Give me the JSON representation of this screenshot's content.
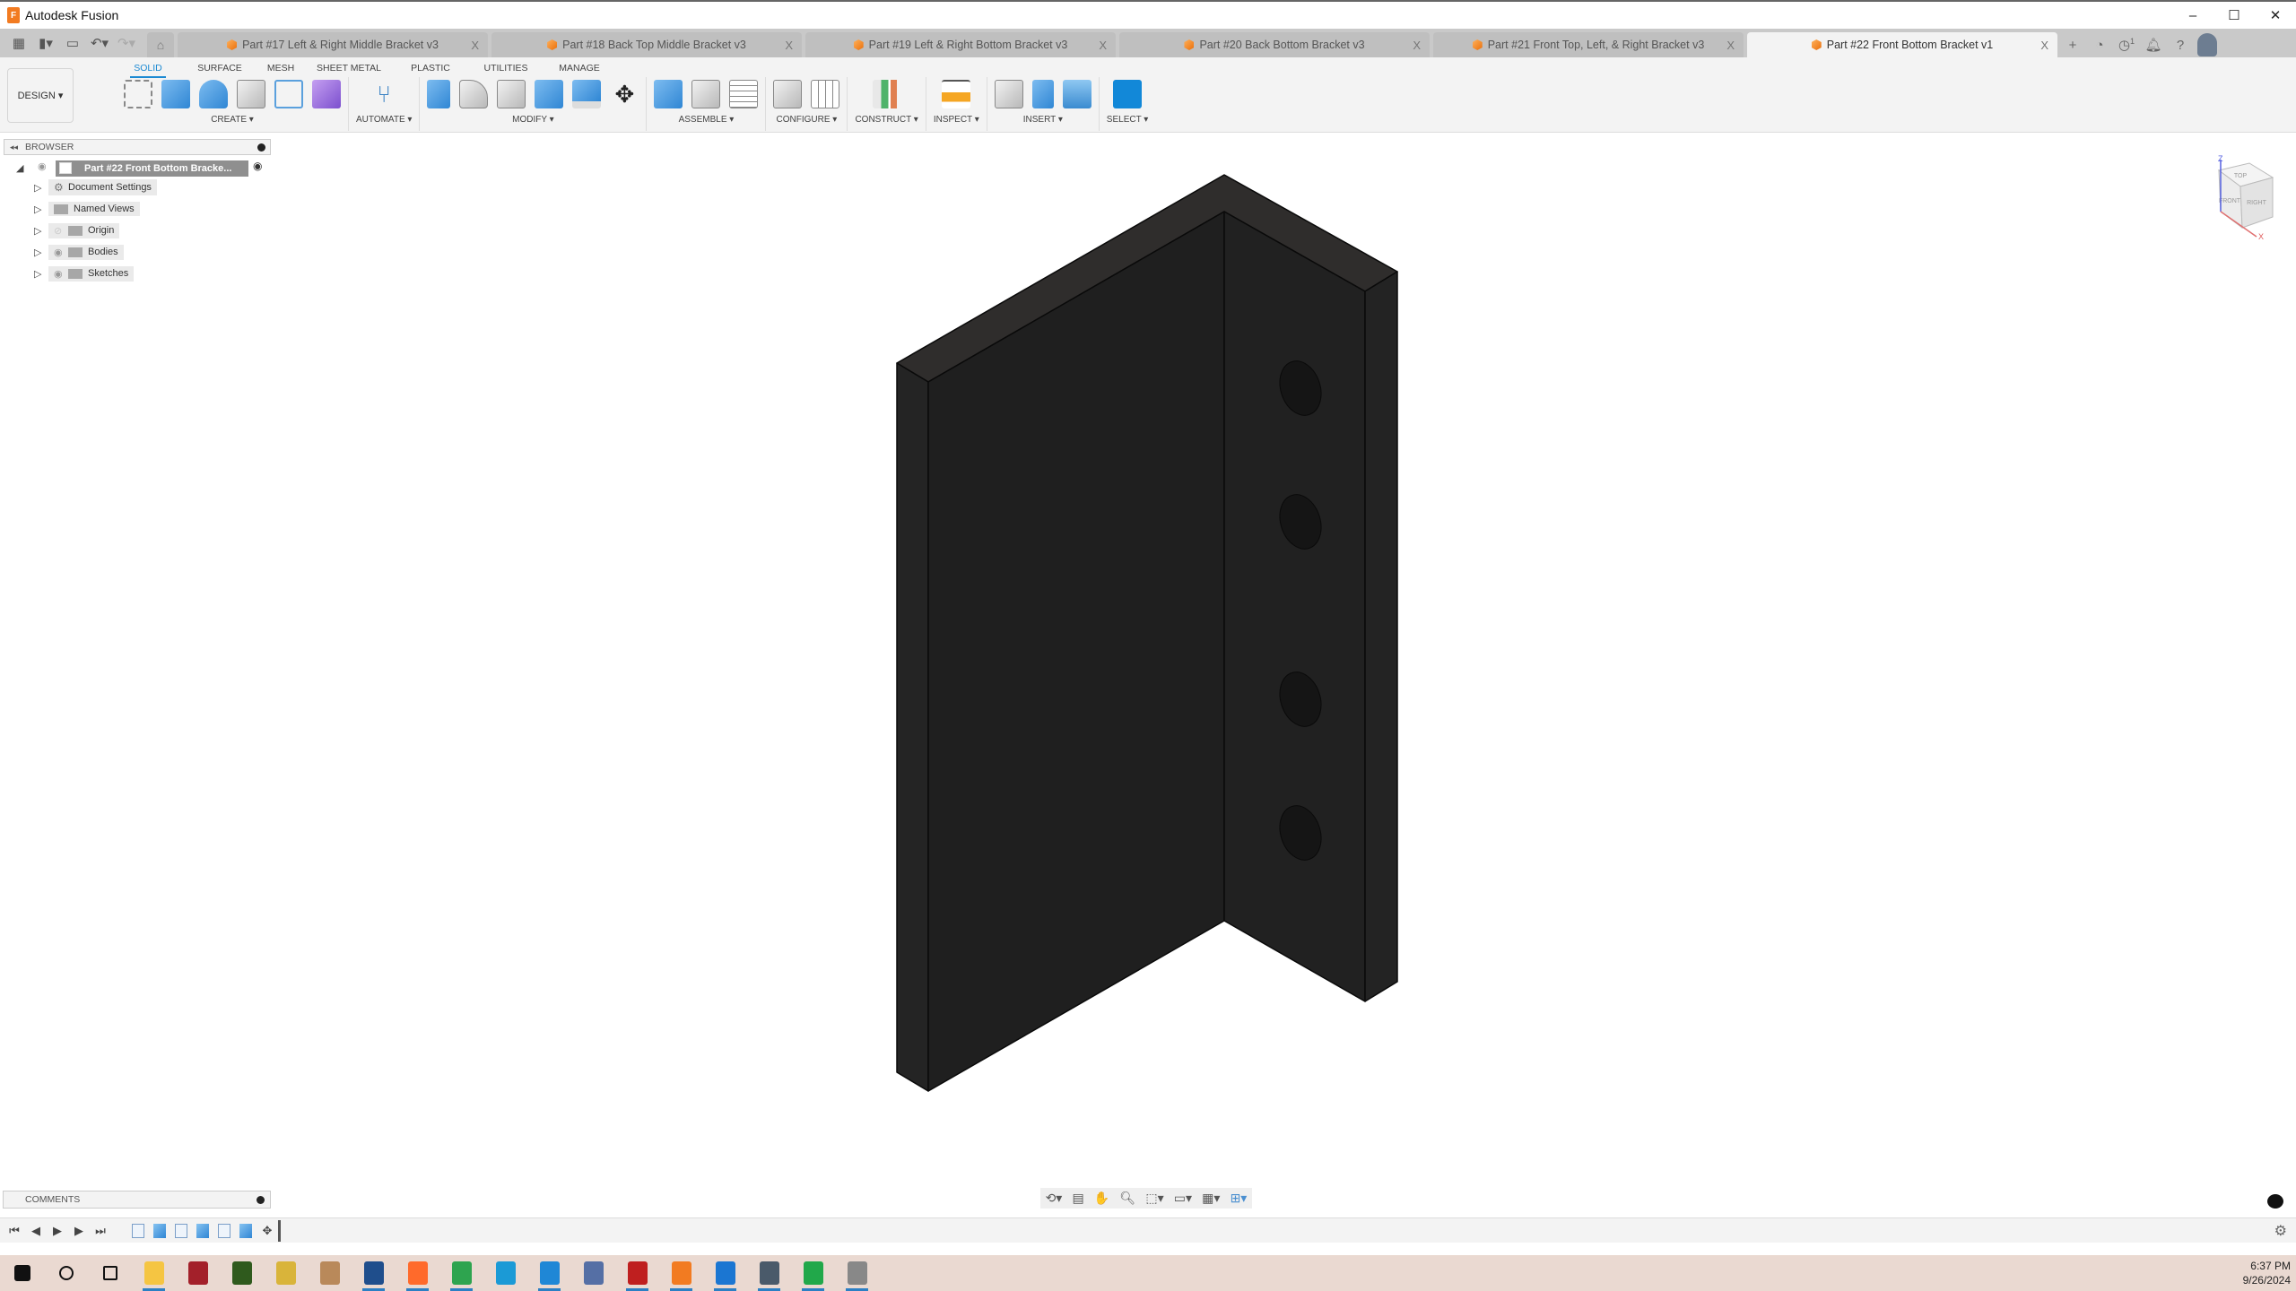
{
  "window": {
    "title": "Autodesk Fusion",
    "controls": [
      "minimize",
      "maximize",
      "close"
    ]
  },
  "quick_access": {
    "icons": [
      "apps-grid-icon",
      "file-icon",
      "save-icon",
      "undo-icon",
      "redo-icon"
    ],
    "home_icon": "home-icon"
  },
  "tabs": [
    {
      "label": "Part #17 Left & Right Middle Bracket v3",
      "active": false
    },
    {
      "label": "Part #18 Back Top Middle Bracket v3",
      "active": false
    },
    {
      "label": "Part #19 Left & Right Bottom Bracket v3",
      "active": false
    },
    {
      "label": "Part #20 Back Bottom Bracket v3",
      "active": false
    },
    {
      "label": "Part #21 Front Top, Left, & Right Bracket v3",
      "active": false
    },
    {
      "label": "Part #22 Front Bottom Bracket v1",
      "active": true
    }
  ],
  "tab_close_glyph": "X",
  "tabbar_right": {
    "new_tab": "+",
    "job_count": "1"
  },
  "workspace": {
    "label": "DESIGN",
    "arrow": "▾"
  },
  "ribbon_tabs": [
    {
      "label": "SOLID",
      "active": true
    },
    {
      "label": "SURFACE",
      "active": false
    },
    {
      "label": "MESH",
      "active": false
    },
    {
      "label": "SHEET METAL",
      "active": false
    },
    {
      "label": "PLASTIC",
      "active": false
    },
    {
      "label": "UTILITIES",
      "active": false
    },
    {
      "label": "MANAGE",
      "active": false
    }
  ],
  "ribbon_groups": [
    {
      "label": "CREATE ▾",
      "tools": [
        "create-sketch",
        "extrude",
        "revolve",
        "hole",
        "rectangular-pattern",
        "create-form"
      ]
    },
    {
      "label": "AUTOMATE ▾",
      "tools": [
        "automate"
      ]
    },
    {
      "label": "MODIFY ▾",
      "tools": [
        "press-pull",
        "fillet",
        "shell",
        "combine",
        "split-body",
        "move-copy"
      ]
    },
    {
      "label": "ASSEMBLE ▾",
      "tools": [
        "new-component",
        "joint",
        "bill-of-materials"
      ]
    },
    {
      "label": "CONFIGURE ▾",
      "tools": [
        "configure-model",
        "configuration-table"
      ]
    },
    {
      "label": "CONSTRUCT ▾",
      "tools": [
        "offset-plane"
      ]
    },
    {
      "label": "INSPECT ▾",
      "tools": [
        "measure"
      ]
    },
    {
      "label": "INSERT ▾",
      "tools": [
        "insert-derive",
        "insert-mcmaster",
        "insert-canvas"
      ]
    },
    {
      "label": "SELECT ▾",
      "tools": [
        "select"
      ]
    }
  ],
  "browser": {
    "title": "BROWSER",
    "root": "Part #22 Front Bottom Bracke...",
    "items": [
      {
        "label": "Document Settings",
        "icon": "gear-icon",
        "visible": null
      },
      {
        "label": "Named Views",
        "icon": "folder-icon",
        "visible": null
      },
      {
        "label": "Origin",
        "icon": "folder-icon",
        "visible": false
      },
      {
        "label": "Bodies",
        "icon": "folder-icon",
        "visible": true
      },
      {
        "label": "Sketches",
        "icon": "folder-icon",
        "visible": true
      }
    ]
  },
  "viewcube": {
    "faces": {
      "top": "TOP",
      "front": "FRONT",
      "right": "RIGHT"
    },
    "axes": {
      "z": "Z",
      "x": "X"
    },
    "colors": {
      "z": "#5560e0",
      "x": "#e05a5a"
    }
  },
  "model": {
    "description": "L-shaped bracket",
    "hole_count": 4,
    "color": "#1e1e1e"
  },
  "comments": {
    "title": "COMMENTS"
  },
  "nav_bar": {
    "tools": [
      "orbit-icon",
      "look-at-icon",
      "pan-icon",
      "zoom-icon",
      "fit-icon",
      "display-settings-icon",
      "grid-icon",
      "viewports-icon"
    ]
  },
  "timeline": {
    "controls": [
      "first",
      "previous",
      "play",
      "next",
      "last"
    ],
    "features": [
      "sketch",
      "extrude",
      "sketch",
      "extrude",
      "sketch",
      "extrude",
      "move"
    ]
  },
  "taskbar": {
    "apps": [
      {
        "name": "start",
        "running": false,
        "color": "#111111"
      },
      {
        "name": "search",
        "running": false,
        "color": "#111111"
      },
      {
        "name": "task-view",
        "running": false,
        "color": "#111111"
      },
      {
        "name": "file-explorer",
        "running": true,
        "color": "#f5c542"
      },
      {
        "name": "everything-search",
        "running": false,
        "color": "#a3202a"
      },
      {
        "name": "app-ss",
        "running": false,
        "color": "#2f5a1d"
      },
      {
        "name": "app-pen",
        "running": false,
        "color": "#d9b43a"
      },
      {
        "name": "app-ruler",
        "running": false,
        "color": "#b9895a"
      },
      {
        "name": "virtualbox",
        "running": true,
        "color": "#1f4e8c"
      },
      {
        "name": "firefox",
        "running": true,
        "color": "#ff6a2b"
      },
      {
        "name": "chrome",
        "running": true,
        "color": "#2ea44f"
      },
      {
        "name": "edge",
        "running": false,
        "color": "#1b9ad6"
      },
      {
        "name": "vscode",
        "running": true,
        "color": "#1f87d6"
      },
      {
        "name": "putty",
        "running": false,
        "color": "#556fa5"
      },
      {
        "name": "filezilla",
        "running": true,
        "color": "#bf1f1f"
      },
      {
        "name": "fusion",
        "running": true,
        "color": "#f27b21"
      },
      {
        "name": "app-c",
        "running": true,
        "color": "#1b76d2"
      },
      {
        "name": "calculator",
        "running": true,
        "color": "#4a5a6a"
      },
      {
        "name": "spreadsheet",
        "running": true,
        "color": "#21a84a"
      },
      {
        "name": "gimp",
        "running": true,
        "color": "#888888"
      }
    ],
    "clock": {
      "time": "6:37 PM",
      "date": "9/26/2024"
    }
  }
}
